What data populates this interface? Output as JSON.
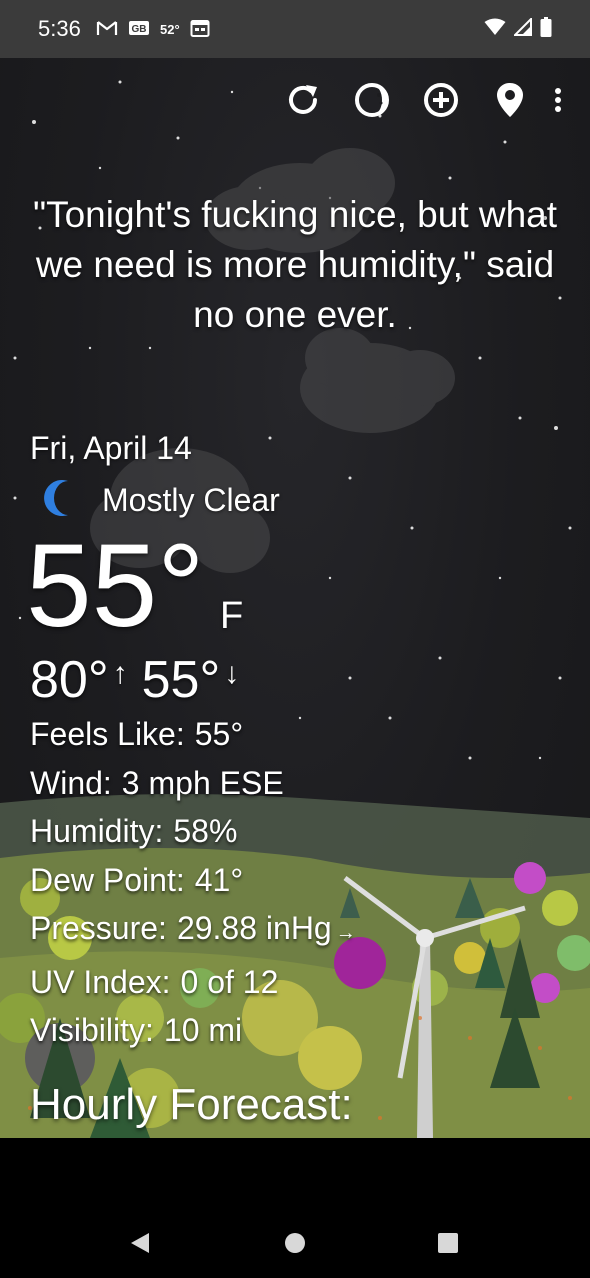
{
  "status_bar": {
    "time": "5:36",
    "temp_badge": "52°",
    "left_icons": [
      "gmail-icon",
      "gb-icon",
      "calendar-icon"
    ],
    "right_icons": [
      "wifi-icon",
      "signal-icon",
      "battery-icon"
    ]
  },
  "toolbar": {
    "icons": [
      "refresh-icon",
      "moon-phase-icon",
      "add-location-icon",
      "location-pin-icon",
      "more-vert-icon"
    ]
  },
  "quote": "\"Tonight's fucking nice, but what we need is more humidity,\" said no one ever.",
  "current": {
    "date": "Fri, April 14",
    "condition": "Mostly Clear",
    "condition_icon": "crescent-moon-icon",
    "temperature": "55°",
    "unit": "F",
    "high": "80°",
    "low": "55°"
  },
  "details": {
    "feels_like_label": "Feels Like:",
    "feels_like_value": "55°",
    "wind_label": "Wind:",
    "wind_value": "3 mph ESE",
    "humidity_label": "Humidity:",
    "humidity_value": "58%",
    "dew_point_label": "Dew Point:",
    "dew_point_value": "41°",
    "pressure_label": "Pressure:",
    "pressure_value": "29.88 inHg",
    "pressure_trend": "→",
    "uv_label": "UV Index:",
    "uv_value": "0 of 12",
    "visibility_label": "Visibility:",
    "visibility_value": "10 mi"
  },
  "hourly": {
    "title": "Hourly Forecast:"
  },
  "colors": {
    "status_bar_bg": "#3b3b3b",
    "sky": "#1c1c1f",
    "moon_icon": "#2f7fe0",
    "ground": "#7f8f45",
    "nav_bar_bg": "#000000"
  },
  "nav": {
    "buttons": [
      "back-icon",
      "home-icon",
      "recents-icon"
    ]
  }
}
